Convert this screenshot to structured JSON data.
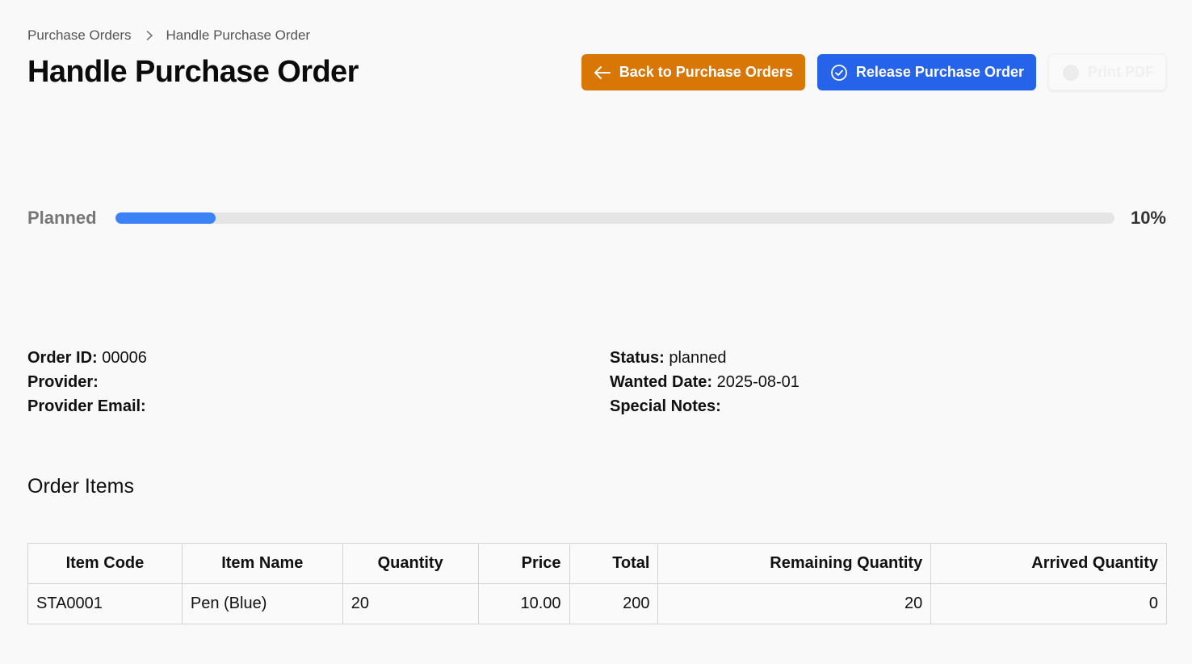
{
  "breadcrumb": {
    "items": [
      "Purchase Orders",
      "Handle Purchase Order"
    ]
  },
  "page": {
    "title": "Handle Purchase Order"
  },
  "actions": {
    "back_label": "Back to Purchase Orders",
    "release_label": "Release Purchase Order",
    "print_label": "Print PDF"
  },
  "progress": {
    "label": "Planned",
    "percent_text": "10%",
    "percent": 10,
    "color": "#3b82f6"
  },
  "order": {
    "order_id_label": "Order ID:",
    "order_id": "00006",
    "provider_label": "Provider:",
    "provider": "",
    "provider_email_label": "Provider Email:",
    "provider_email": "",
    "status_label": "Status:",
    "status": "planned",
    "wanted_date_label": "Wanted Date:",
    "wanted_date": "2025-08-01",
    "special_notes_label": "Special Notes:",
    "special_notes": ""
  },
  "items_section": {
    "title": "Order Items",
    "columns": [
      "Item Code",
      "Item Name",
      "Quantity",
      "Price",
      "Total",
      "Remaining Quantity",
      "Arrived Quantity"
    ],
    "rows": [
      [
        "STA0001",
        "Pen (Blue)",
        "20",
        "10.00",
        "200",
        "20",
        "0"
      ]
    ]
  },
  "colors": {
    "back_button": "#d97706",
    "release_button": "#2563eb"
  },
  "icons": {
    "back": "arrow-left-icon",
    "release": "check-circle-icon",
    "print": "printer-icon",
    "breadcrumb_sep": "chevron-right-icon"
  }
}
